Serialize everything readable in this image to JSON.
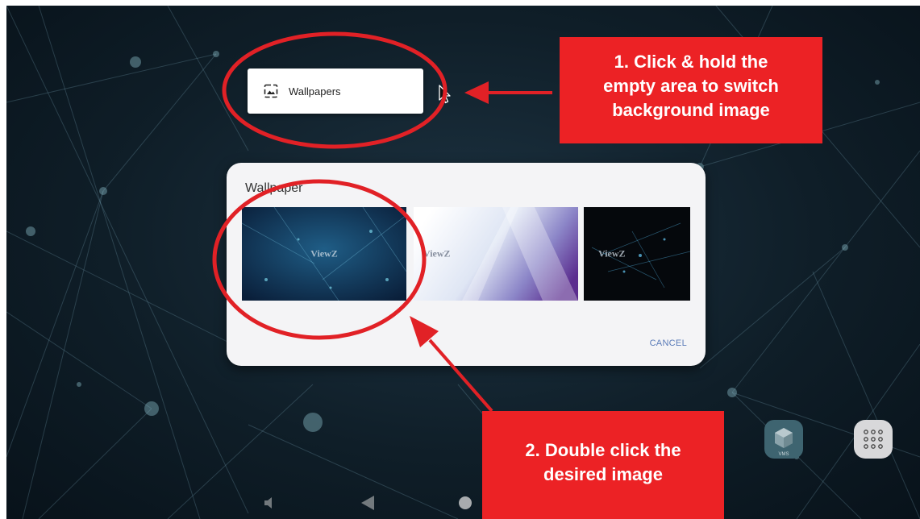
{
  "popup": {
    "label": "Wallpapers",
    "icon": "wallpaper-icon"
  },
  "dialog": {
    "title": "Wallpaper",
    "thumbnails": [
      {
        "name": "blue-network-wallpaper",
        "watermark": "ViewZ"
      },
      {
        "name": "purple-white-wallpaper",
        "watermark": "ViewZ"
      },
      {
        "name": "dark-network-wallpaper",
        "watermark": "ViewZ"
      }
    ],
    "cancel_label": "CANCEL"
  },
  "callouts": {
    "step1": [
      "1. Click & hold the",
      "empty area to switch",
      "background image"
    ],
    "step2": [
      "2. Double click the",
      "desired image"
    ]
  },
  "dock": {
    "vms_label": "VMS"
  },
  "colors": {
    "callout": "#ec2225",
    "cancel": "#5a7bb8"
  }
}
